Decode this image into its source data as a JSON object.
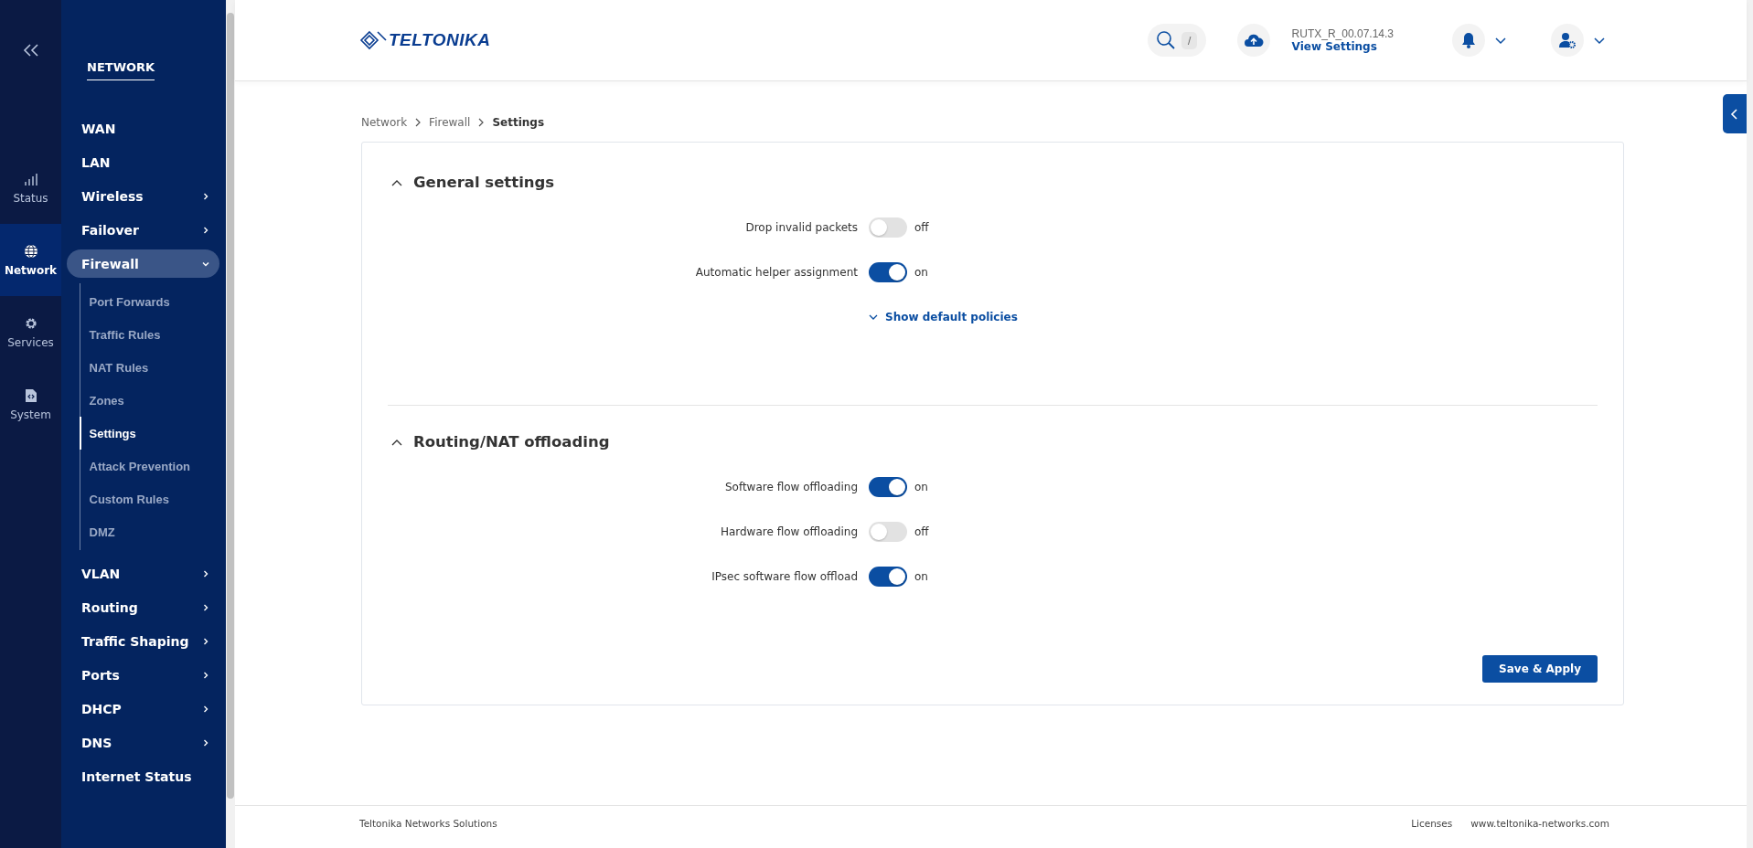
{
  "rail": {
    "items": [
      {
        "label": "Status",
        "kind": "signal",
        "selected": false
      },
      {
        "label": "Network",
        "kind": "globe",
        "selected": true
      },
      {
        "label": "Services",
        "kind": "gear",
        "selected": false
      },
      {
        "label": "System",
        "kind": "file",
        "selected": false
      }
    ]
  },
  "nav": {
    "title": "NETWORK",
    "items": [
      {
        "label": "WAN",
        "has_submenu": false,
        "expanded": false
      },
      {
        "label": "LAN",
        "has_submenu": false,
        "expanded": false
      },
      {
        "label": "Wireless",
        "has_submenu": true,
        "expanded": false
      },
      {
        "label": "Failover",
        "has_submenu": true,
        "expanded": false
      },
      {
        "label": "Firewall",
        "has_submenu": true,
        "expanded": true,
        "children": [
          {
            "label": "Port Forwards",
            "selected": false
          },
          {
            "label": "Traffic Rules",
            "selected": false
          },
          {
            "label": "NAT Rules",
            "selected": false
          },
          {
            "label": "Zones",
            "selected": false
          },
          {
            "label": "Settings",
            "selected": true
          },
          {
            "label": "Attack Prevention",
            "selected": false
          },
          {
            "label": "Custom Rules",
            "selected": false
          },
          {
            "label": "DMZ",
            "selected": false
          }
        ]
      },
      {
        "label": "VLAN",
        "has_submenu": true,
        "expanded": false
      },
      {
        "label": "Routing",
        "has_submenu": true,
        "expanded": false
      },
      {
        "label": "Traffic Shaping",
        "has_submenu": true,
        "expanded": false
      },
      {
        "label": "Ports",
        "has_submenu": true,
        "expanded": false
      },
      {
        "label": "DHCP",
        "has_submenu": true,
        "expanded": false
      },
      {
        "label": "DNS",
        "has_submenu": true,
        "expanded": false
      },
      {
        "label": "Internet Status",
        "has_submenu": false,
        "expanded": false
      }
    ]
  },
  "header": {
    "logo": "TELTONIKA",
    "search_shortcut": "/",
    "firmware": "RUTX_R_00.07.14.3",
    "firmware_link": "View Settings"
  },
  "breadcrumb": [
    {
      "label": "Network",
      "current": false
    },
    {
      "label": "Firewall",
      "current": false
    },
    {
      "label": "Settings",
      "current": true
    }
  ],
  "sections": [
    {
      "title": "General settings",
      "expanded": true,
      "toggles": [
        {
          "label": "Drop invalid packets",
          "on": false,
          "state_text": "off"
        },
        {
          "label": "Automatic helper assignment",
          "on": true,
          "state_text": "on"
        }
      ],
      "link": "Show default policies"
    },
    {
      "title": "Routing/NAT offloading",
      "expanded": true,
      "toggles": [
        {
          "label": "Software flow offloading",
          "on": true,
          "state_text": "on"
        },
        {
          "label": "Hardware flow offloading",
          "on": false,
          "state_text": "off"
        },
        {
          "label": "IPsec software flow offload",
          "on": true,
          "state_text": "on"
        }
      ]
    }
  ],
  "save_button": "Save & Apply",
  "footer": {
    "left": "Teltonika Networks Solutions",
    "links": [
      "Licenses",
      "www.teltonika-networks.com"
    ]
  }
}
